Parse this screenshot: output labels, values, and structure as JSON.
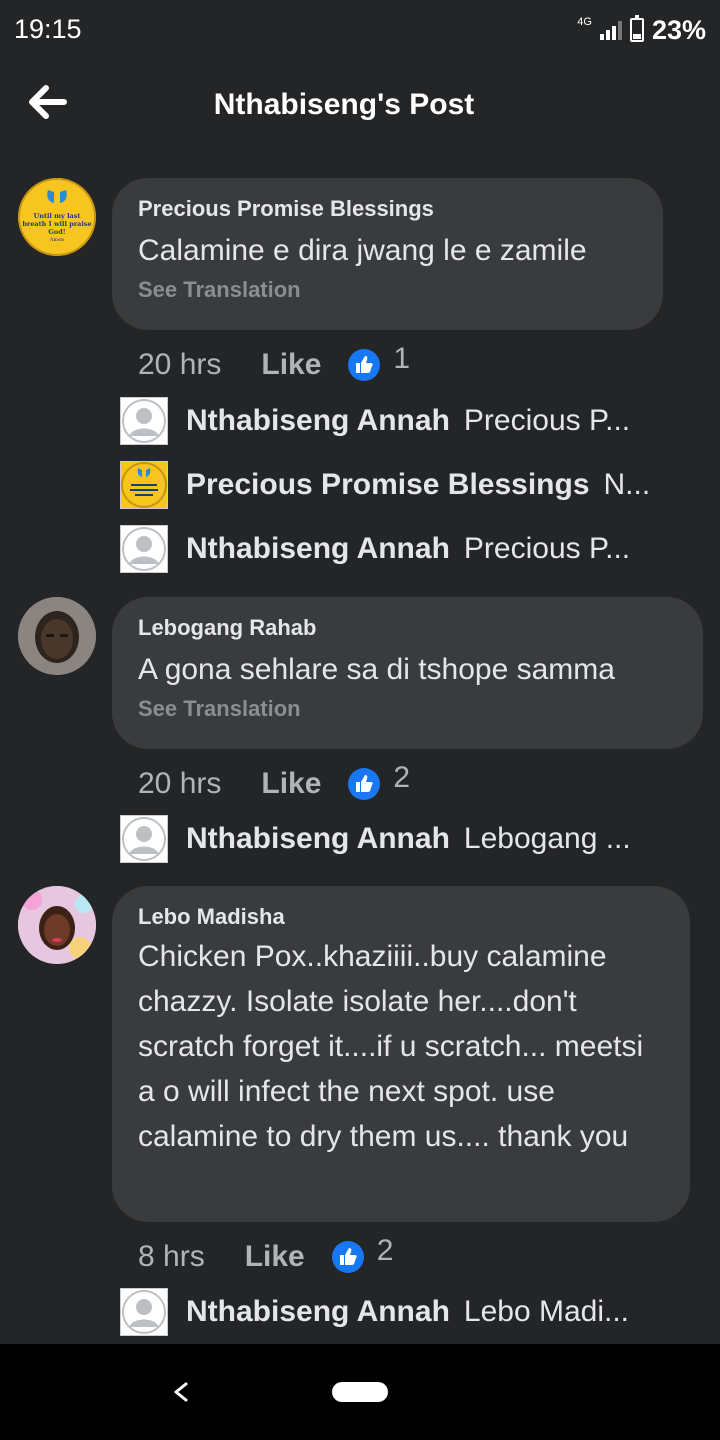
{
  "status_bar": {
    "time": "19:15",
    "network": "4G",
    "battery": "23%"
  },
  "header": {
    "title": "Nthabiseng's Post",
    "back_icon": "arrow-left-icon"
  },
  "comments": [
    {
      "author": "Precious Promise Blessings",
      "text": "Calamine e dira jwang le e zamile",
      "see_translation": "See Translation",
      "time": "20 hrs",
      "like": "Like",
      "reaction_icon": "thumbs-up-icon",
      "reaction_count": "1",
      "avatar_text": [
        "Until my last",
        "breath I will praise",
        "God!",
        "Amen"
      ],
      "replies": [
        {
          "name": "Nthabiseng Annah",
          "preview": "Precious P..."
        },
        {
          "name": "Precious Promise Blessings",
          "preview": "N..."
        },
        {
          "name": "Nthabiseng Annah",
          "preview": "Precious P..."
        }
      ]
    },
    {
      "author": "Lebogang Rahab",
      "text": "A gona sehlare sa di tshope samma",
      "see_translation": "See Translation",
      "time": "20 hrs",
      "like": "Like",
      "reaction_icon": "thumbs-up-icon",
      "reaction_count": "2",
      "replies": [
        {
          "name": "Nthabiseng Annah",
          "preview": "Lebogang ..."
        }
      ]
    },
    {
      "author": "Lebo Madisha",
      "text": "Chicken Pox..khaziiii..buy calamine chazzy. Isolate isolate her....don't scratch forget it....if u scratch... meetsi a o will infect the next spot. use calamine to dry them us.... thank you",
      "time": "8 hrs",
      "like": "Like",
      "reaction_icon": "thumbs-up-icon",
      "reaction_count": "2",
      "replies": [
        {
          "name": "Nthabiseng Annah",
          "preview": "Lebo Madi..."
        }
      ]
    }
  ],
  "colors": {
    "background": "#242526",
    "bubble": "#3a3b3c",
    "like_blue": "#1877f2",
    "muted": "#b0b3b8"
  }
}
